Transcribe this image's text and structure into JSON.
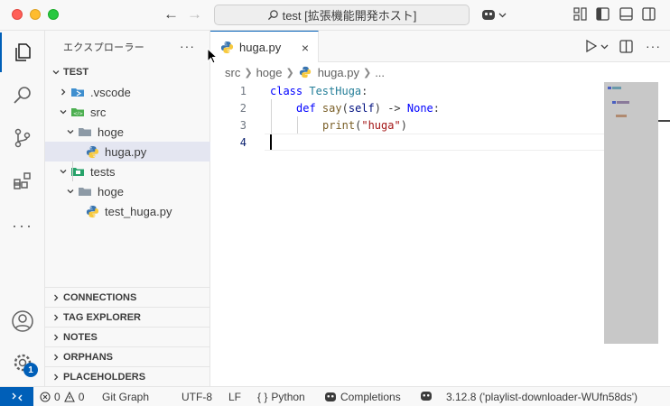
{
  "window": {
    "title": "test [拡張機能開発ホスト]"
  },
  "sidebar": {
    "title": "エクスプローラー",
    "more": "···",
    "root": "TEST",
    "tree": [
      {
        "label": ".vscode",
        "icon": "vscode-folder-icon",
        "depth": 1,
        "expanded": false
      },
      {
        "label": "src",
        "icon": "src-folder-icon",
        "depth": 1,
        "expanded": true
      },
      {
        "label": "hoge",
        "icon": "folder-icon",
        "depth": 2,
        "expanded": true
      },
      {
        "label": "huga.py",
        "icon": "python-icon",
        "depth": 3,
        "selected": true
      },
      {
        "label": "tests",
        "icon": "tests-folder-icon",
        "depth": 1,
        "expanded": true
      },
      {
        "label": "hoge",
        "icon": "folder-icon",
        "depth": 2,
        "expanded": true
      },
      {
        "label": "test_huga.py",
        "icon": "python-icon",
        "depth": 3
      }
    ],
    "panels": [
      "CONNECTIONS",
      "TAG EXPLORER",
      "NOTES",
      "ORPHANS",
      "PLACEHOLDERS"
    ]
  },
  "activity": {
    "account_badge": "1"
  },
  "editor": {
    "tab_label": "huga.py",
    "tab_close": "×",
    "breadcrumb": [
      "src",
      "hoge",
      "huga.py",
      "..."
    ],
    "lines": [
      {
        "n": "1"
      },
      {
        "n": "2"
      },
      {
        "n": "3"
      },
      {
        "n": "4"
      }
    ],
    "code": {
      "l1_kw": "class",
      "l1_name": "TestHuga",
      "l1_colon": ":",
      "l2_kw": "def",
      "l2_fn": "say",
      "l2_open": "(",
      "l2_self": "self",
      "l2_arrow": ") -> ",
      "l2_none": "None",
      "l2_colon": ":",
      "l3_fn": "print",
      "l3_open": "(",
      "l3_str": "\"huga\"",
      "l3_close": ")"
    }
  },
  "statusbar": {
    "problems_errors": "0",
    "problems_warnings": "0",
    "git_graph": "Git Graph",
    "encoding": "UTF-8",
    "eol": "LF",
    "language": "Python",
    "language_braces": "{ }",
    "copilot": "Completions",
    "interpreter": "3.12.8 ('playlist-downloader-WUfn58ds')"
  },
  "colors": {
    "accent": "#005fb8",
    "selection": "#e4e6f1"
  }
}
